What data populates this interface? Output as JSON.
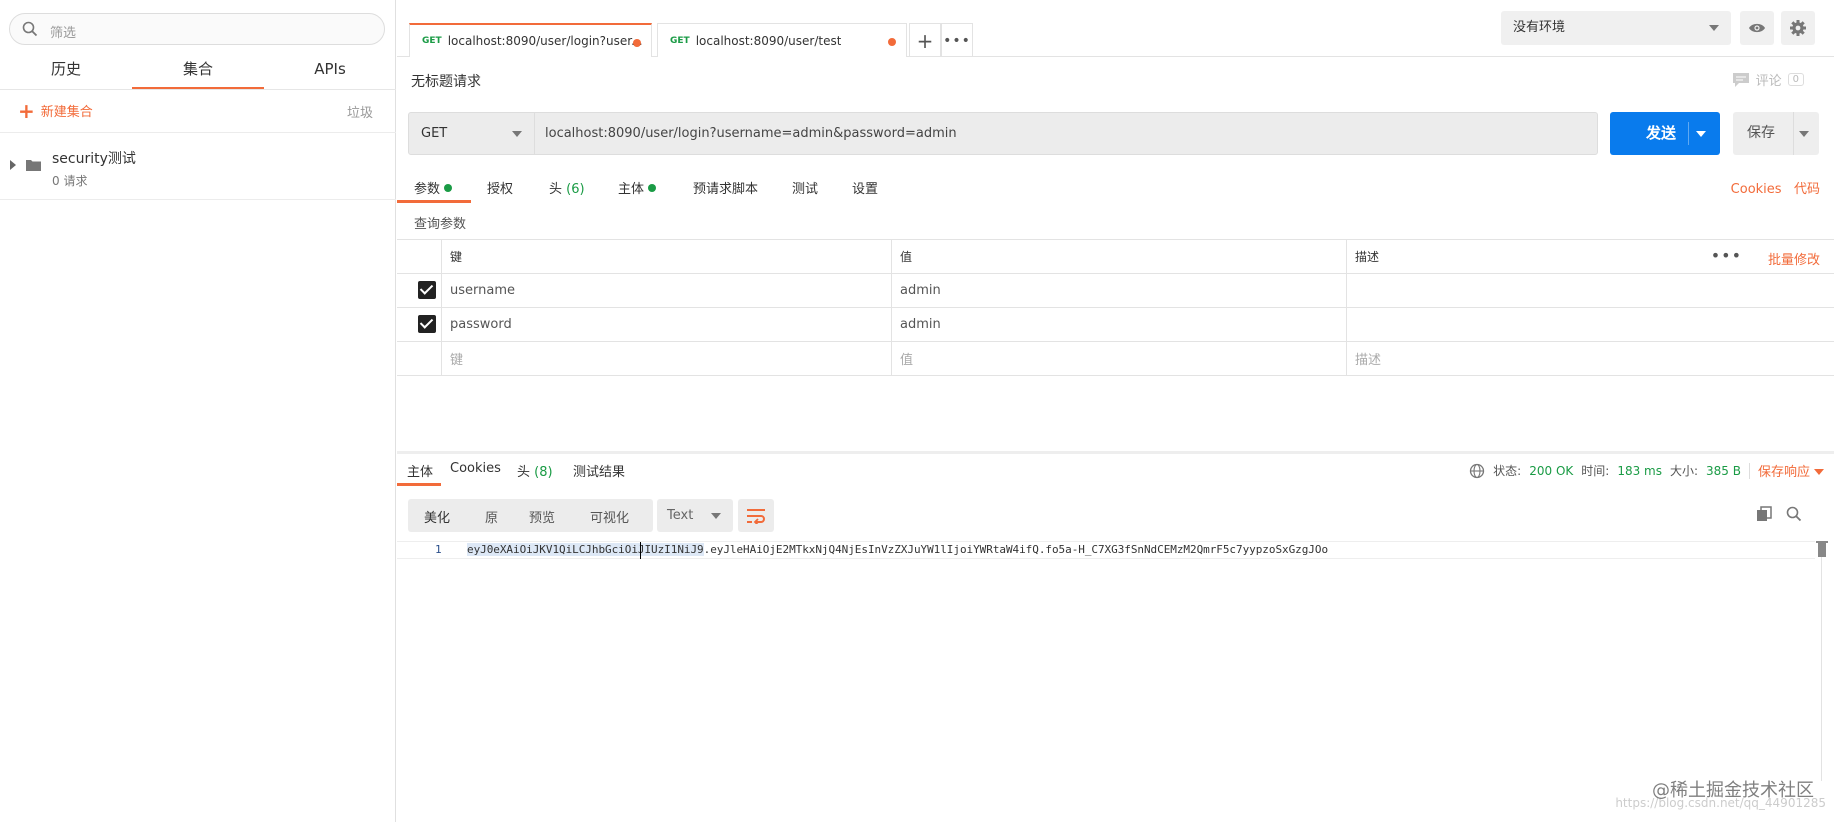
{
  "sidebar": {
    "search_placeholder": "筛选",
    "tabs": [
      {
        "label": "历史"
      },
      {
        "label": "集合"
      },
      {
        "label": "APIs"
      }
    ],
    "new_collection": "新建集合",
    "trash": "垃圾",
    "collections": [
      {
        "name": "security测试",
        "count": "0 请求"
      }
    ]
  },
  "tabs": [
    {
      "method": "GET",
      "title": "localhost:8090/user/login?user..."
    },
    {
      "method": "GET",
      "title": "localhost:8090/user/test"
    }
  ],
  "environment": {
    "selected": "没有环境"
  },
  "request": {
    "title": "无标题请求",
    "comment_label": "评论",
    "comment_count": "0",
    "method": "GET",
    "url": "localhost:8090/user/login?username=admin&password=admin",
    "send_label": "发送",
    "save_label": "保存"
  },
  "request_tabs": {
    "params": "参数",
    "auth": "授权",
    "headers": "头",
    "headers_count": "(6)",
    "body": "主体",
    "prerequest": "预请求脚本",
    "tests": "测试",
    "settings": "设置",
    "cookies": "Cookies",
    "code": "代码"
  },
  "params": {
    "section_title": "查询参数",
    "headers": {
      "key": "键",
      "value": "值",
      "description": "描述"
    },
    "bulk_edit": "批量修改",
    "rows": [
      {
        "checked": true,
        "key": "username",
        "value": "admin",
        "description": ""
      },
      {
        "checked": true,
        "key": "password",
        "value": "admin",
        "description": ""
      }
    ],
    "placeholders": {
      "key": "键",
      "value": "值",
      "description": "描述"
    }
  },
  "response_tabs": {
    "body": "主体",
    "cookies": "Cookies",
    "headers": "头",
    "headers_count": "(8)",
    "test_results": "测试结果"
  },
  "response_status": {
    "status_label": "状态:",
    "status_value": "200 OK",
    "time_label": "时间:",
    "time_value": "183 ms",
    "size_label": "大小:",
    "size_value": "385 B",
    "save_response": "保存响应"
  },
  "response_view": {
    "modes": [
      "美化",
      "原",
      "预览",
      "可视化"
    ],
    "format": "Text"
  },
  "response_body": {
    "line_number": "1",
    "text_highlighted_a": "eyJ0eXAiOiJKV1QiLCJhbGci",
    "text_highlighted_b": "OiJIUzI1NiJ9",
    "text_rest": ".eyJleHAiOjE2MTkxNjQ4NjEsInVzZXJuYW1lIjoiYWRtaW4ifQ.fo5a-H_C7XG3fSnNdCEMzM2QmrF5c7yypzoSxGzgJOo"
  },
  "watermark": "@稀土掘金技术社区",
  "watermark_faint": "https://blog.csdn.net/qq_44901285",
  "colors": {
    "accent": "#f26b3a",
    "send": "#097bed",
    "green": "#1a9b45"
  },
  "icons": [
    "search-icon",
    "plus-icon",
    "folder-icon",
    "more-icon",
    "eye-icon",
    "gear-icon",
    "comment-icon",
    "globe-icon",
    "wrap-icon",
    "copy-icon"
  ]
}
